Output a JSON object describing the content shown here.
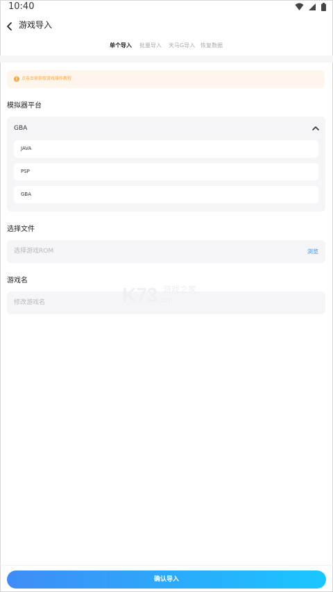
{
  "status_bar": {
    "time": "10:40"
  },
  "header": {
    "title": "游戏导入"
  },
  "tabs": [
    {
      "label": "单个导入",
      "active": true
    },
    {
      "label": "批量导入",
      "active": false
    },
    {
      "label": "天马G导入",
      "active": false
    },
    {
      "label": "恢复数据",
      "active": false
    }
  ],
  "tip": {
    "text": "点击合家获取游戏操作教程"
  },
  "platform": {
    "label": "模拟器平台",
    "selected": "GBA",
    "options": [
      "JAVA",
      "PSP",
      "GBA"
    ]
  },
  "file": {
    "label": "选择文件",
    "placeholder": "选择游戏ROM",
    "browse_label": "浏览"
  },
  "game_name": {
    "label": "游戏名",
    "placeholder": "修改游戏名"
  },
  "watermark": {
    "logo": "K73",
    "site": "游戏之家",
    "domain": ".com"
  },
  "confirm": {
    "label": "确认导入"
  },
  "colors": {
    "accent": "#2b8ff0",
    "tip_text": "#f5a543",
    "tip_bg": "#fef6ec",
    "button_start": "#3f8cf6",
    "button_end": "#1ac6fe"
  }
}
